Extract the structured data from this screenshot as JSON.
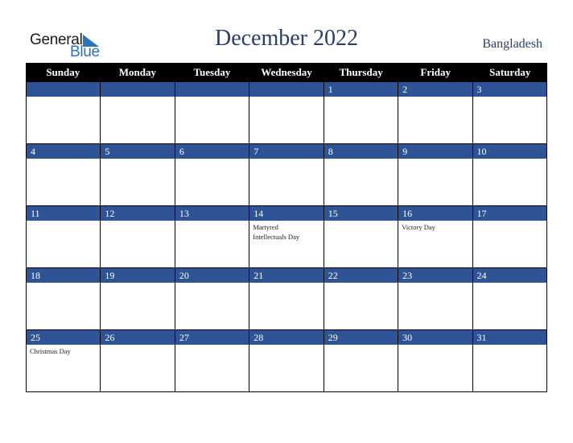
{
  "logo": {
    "word1": "General",
    "word2": "Blue"
  },
  "title": "December 2022",
  "country": "Bangladesh",
  "colors": {
    "header_bg": "#000000",
    "band": "#2f5496",
    "title": "#2c3e66",
    "logo_blue": "#2a74b8"
  },
  "weekdays": [
    "Sunday",
    "Monday",
    "Tuesday",
    "Wednesday",
    "Thursday",
    "Friday",
    "Saturday"
  ],
  "weeks": [
    [
      {
        "day": ""
      },
      {
        "day": ""
      },
      {
        "day": ""
      },
      {
        "day": ""
      },
      {
        "day": "1"
      },
      {
        "day": "2"
      },
      {
        "day": "3"
      }
    ],
    [
      {
        "day": "4"
      },
      {
        "day": "5"
      },
      {
        "day": "6"
      },
      {
        "day": "7"
      },
      {
        "day": "8"
      },
      {
        "day": "9"
      },
      {
        "day": "10"
      }
    ],
    [
      {
        "day": "11"
      },
      {
        "day": "12"
      },
      {
        "day": "13"
      },
      {
        "day": "14",
        "event": "Martyred Intellectuals Day"
      },
      {
        "day": "15"
      },
      {
        "day": "16",
        "event": "Victory Day"
      },
      {
        "day": "17"
      }
    ],
    [
      {
        "day": "18"
      },
      {
        "day": "19"
      },
      {
        "day": "20"
      },
      {
        "day": "21"
      },
      {
        "day": "22"
      },
      {
        "day": "23"
      },
      {
        "day": "24"
      }
    ],
    [
      {
        "day": "25",
        "event": "Christmas Day"
      },
      {
        "day": "26"
      },
      {
        "day": "27"
      },
      {
        "day": "28"
      },
      {
        "day": "29"
      },
      {
        "day": "30"
      },
      {
        "day": "31"
      }
    ]
  ]
}
